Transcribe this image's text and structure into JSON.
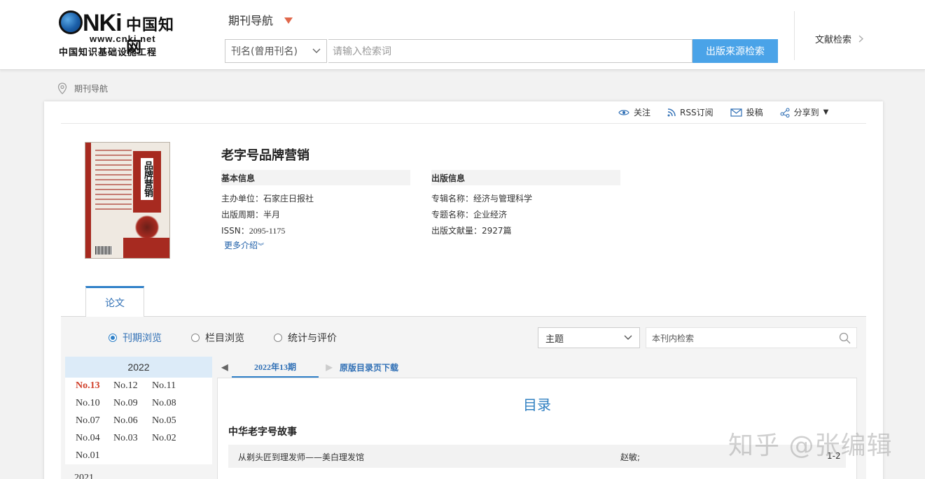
{
  "logo": {
    "mark": "NKi",
    "chinese_name": "中国知网",
    "url": "www.cnki.net",
    "subtitle": "中国知识基础设施工程"
  },
  "header": {
    "nav_title": "期刊导航",
    "search_field": "刊名(曾用刊名)",
    "search_placeholder": "请输入检索词",
    "search_button": "出版来源检索",
    "literature_search": "文献检索"
  },
  "breadcrumb": {
    "label": "期刊导航"
  },
  "actions": {
    "follow": "关注",
    "rss": "RSS订阅",
    "submit": "投稿",
    "share": "分享到"
  },
  "cover": {
    "title": "品牌营销",
    "brand": "老字号"
  },
  "journal": {
    "title": "老字号品牌营销",
    "basic_info": {
      "heading": "基本信息",
      "sponsor_label": "主办单位：",
      "sponsor": "石家庄日报社",
      "period_label": "出版周期：",
      "period": "半月",
      "issn_label": "ISSN：",
      "issn": "2095-1175",
      "more": "更多介绍"
    },
    "pub_info": {
      "heading": "出版信息",
      "album_label": "专辑名称：",
      "album": "经济与管理科学",
      "topic_label": "专题名称：",
      "topic": "企业经济",
      "count_label": "出版文献量：",
      "count": "2927篇"
    }
  },
  "tabs": {
    "paper": "论文"
  },
  "browse": {
    "by_issue": "刊期浏览",
    "by_column": "栏目浏览",
    "stats": "统计与评价",
    "field": "主题",
    "in_search_placeholder": "本刊内检索"
  },
  "years": {
    "current": "2022",
    "issues": [
      "No.13",
      "No.12",
      "No.11",
      "No.10",
      "No.09",
      "No.08",
      "No.07",
      "No.06",
      "No.05",
      "No.04",
      "No.03",
      "No.02",
      "No.01"
    ],
    "next_year": "2021"
  },
  "toc": {
    "current_issue": "2022年13期",
    "download": "原版目录页下载",
    "heading": "目录",
    "section": "中华老字号故事",
    "article": {
      "title": "从剃头匠到理发师——美白理发馆",
      "author": "赵敏;",
      "pages": "1-2"
    }
  },
  "watermark": "知乎 @张编辑"
}
